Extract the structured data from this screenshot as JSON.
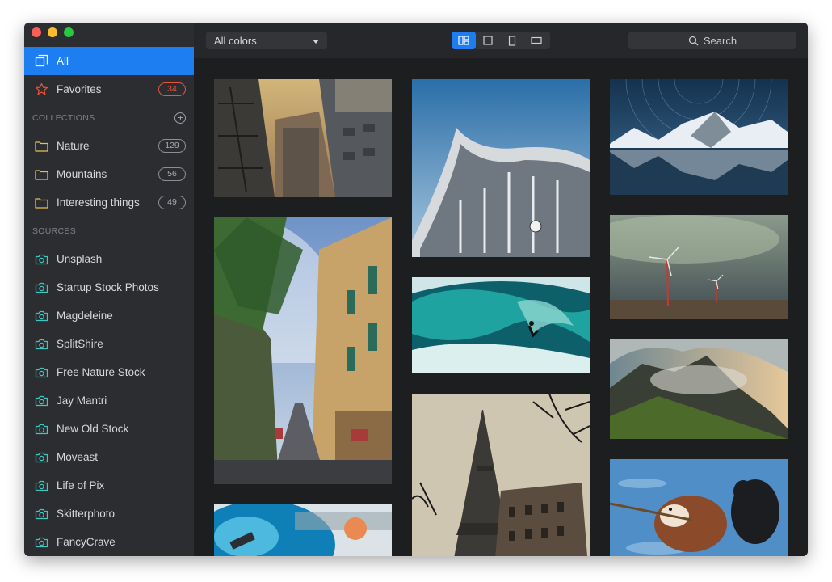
{
  "sidebar": {
    "all": {
      "label": "All"
    },
    "favorites": {
      "label": "Favorites",
      "count": "34"
    },
    "collections_header": "COLLECTIONS",
    "collections": [
      {
        "label": "Nature",
        "count": "129"
      },
      {
        "label": "Mountains",
        "count": "56"
      },
      {
        "label": "Interesting things",
        "count": "49"
      }
    ],
    "sources_header": "SOURCES",
    "sources": [
      {
        "label": "Unsplash"
      },
      {
        "label": "Startup Stock Photos"
      },
      {
        "label": "Magdeleine"
      },
      {
        "label": "SplitShire"
      },
      {
        "label": "Free Nature Stock"
      },
      {
        "label": "Jay Mantri"
      },
      {
        "label": "New Old Stock"
      },
      {
        "label": "Moveast"
      },
      {
        "label": "Life of Pix"
      },
      {
        "label": "Skitterphoto"
      },
      {
        "label": "FancyCrave"
      }
    ]
  },
  "toolbar": {
    "color_filter": "All colors",
    "search_label": "Search",
    "view_modes": [
      "grid",
      "square",
      "portrait",
      "landscape"
    ],
    "active_view": "grid"
  },
  "photos": [
    {
      "subject": "city buildings fire escape"
    },
    {
      "subject": "street with balconies"
    },
    {
      "subject": "blue smoke"
    },
    {
      "subject": "curved building with clock"
    },
    {
      "subject": "surfer in wave"
    },
    {
      "subject": "eiffel tower foggy"
    },
    {
      "subject": "mountains star trails lake"
    },
    {
      "subject": "wind turbines"
    },
    {
      "subject": "misty green mountain"
    },
    {
      "subject": "dogs in water with stick"
    }
  ],
  "colors": {
    "accent": "#1d7ef2",
    "sidebar_bg": "#2b2d31",
    "main_bg": "#1d1e20",
    "favorites_badge": "#e8553f",
    "folder_icon": "#e6c24a",
    "camera_icon": "#3cc7c0"
  }
}
